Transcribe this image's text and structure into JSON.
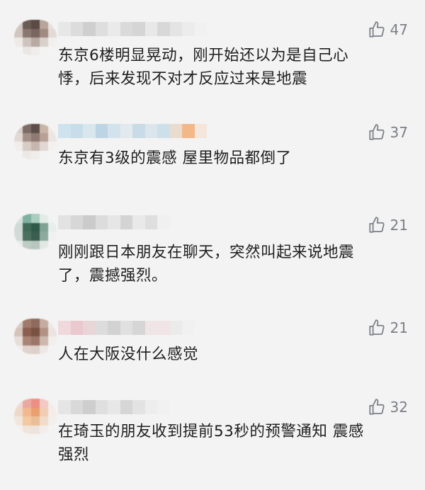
{
  "comments": [
    {
      "likes": "47",
      "text": "东京6楼明显晃动，刚开始还以为是自己心\n悸，后来发现不对才反应过来是地震",
      "avatar_colors": [
        "#cfc7c2",
        "#6b5b55",
        "#5a4a45",
        "#b9a49b",
        "#e8e0dc",
        "#d2c6c0",
        "#8a7770",
        "#7a6660",
        "#a08a82",
        "#e2dad6",
        "#eeeae8",
        "#cfc4bf",
        "#b8a9a3",
        "#d9d0cc",
        "#f2f0ef",
        "#f4f4f4",
        "#e9e6e4",
        "#efedec",
        "#f3f3f3",
        "#f4f4f4"
      ],
      "name_colors": [
        "#e7e7e7",
        "#dcdcdc",
        "#cfcfcf",
        "#dedede",
        "#eaeaea",
        "#dadada",
        "#d5d5d5",
        "#e8e8e8",
        "#d8d8d8",
        "#e4e4e4",
        "#ececec",
        "#f1f1f1"
      ]
    },
    {
      "likes": "37",
      "text": "东京有3级的震感 屋里物品都倒了",
      "avatar_colors": [
        "#d8cfcb",
        "#7d6b66",
        "#5d4e4a",
        "#c9b4a8",
        "#efe8e4",
        "#e3d9d4",
        "#a39089",
        "#8e7a73",
        "#b8a096",
        "#ece6e2",
        "#f0edeb",
        "#d7ccc6",
        "#c7b6ae",
        "#e1d8d3",
        "#f3f1f0",
        "#f4f4f4",
        "#ebe8e6",
        "#efedec",
        "#f3f3f3",
        "#f4f4f4"
      ],
      "name_colors": [
        "#cfe3ee",
        "#c8dde9",
        "#d9e6ee",
        "#bcd4e3",
        "#d3e3ed",
        "#e2eaef",
        "#c9dbe6",
        "#dbe5ec",
        "#cde0ea",
        "#e9dccf",
        "#f2b88a",
        "#f3e6dc"
      ]
    },
    {
      "likes": "21",
      "text": "刚刚跟日本朋友在聊天，突然叫起来说地震\n了，震撼强烈。",
      "avatar_colors": [
        "#d7e2de",
        "#7fb0a0",
        "#a9cdbf",
        "#e3ebe8",
        "#f1f3f2",
        "#cfd9d5",
        "#3f6b5a",
        "#2f5a48",
        "#7fa293",
        "#e8eeeb",
        "#d2dbd7",
        "#4b6f60",
        "#3a5e4f",
        "#8eaa9e",
        "#eef1f0",
        "#e6ebe9",
        "#bfccc6",
        "#b8c6c0",
        "#e2e8e5",
        "#f3f3f3"
      ],
      "name_colors": [
        "#e2e2e2",
        "#d7d7d7",
        "#cbcbcb",
        "#dcdcdc",
        "#e6e6e6",
        "#d4d4d4",
        "#e9e9e9",
        "#dedede",
        "#f0f0f0",
        "#f3f3f3",
        "#f3f3f3",
        "#f3f3f3"
      ]
    },
    {
      "likes": "21",
      "text": "人在大阪没什么感觉",
      "avatar_colors": [
        "#d9ccc6",
        "#a07a6c",
        "#8f6a5d",
        "#c4aca2",
        "#eee8e5",
        "#d6c3ba",
        "#8b5e4f",
        "#7a5244",
        "#b39284",
        "#ebe4e0",
        "#e8ddd8",
        "#a98576",
        "#9c7768",
        "#cdb8ae",
        "#f1eeec",
        "#f0ece9",
        "#e0d3cd",
        "#ddd0ca",
        "#ede8e5",
        "#f4f4f4"
      ],
      "name_colors": [
        "#f0d9dd",
        "#eac8ce",
        "#e8d5d8",
        "#dcdcdc",
        "#d2d2d2",
        "#e0e0e0",
        "#d6d6d6",
        "#efe4e6",
        "#f2e3e6",
        "#ebebeb",
        "#f1f1f1",
        "#f3f3f3"
      ]
    },
    {
      "likes": "32",
      "text": "在琦玉的朋友收到提前53秒的预警通知 震感\n强烈",
      "avatar_colors": [
        "#f1d7d3",
        "#e9a8a0",
        "#ee8f86",
        "#f2c9c4",
        "#f3ecea",
        "#eed9c8",
        "#f2b98f",
        "#e9a06e",
        "#f0cdb4",
        "#f3ece7",
        "#f1e6dd",
        "#f2c9a0",
        "#eabf98",
        "#f1dccb",
        "#f3efec",
        "#f3f0ed",
        "#efe5dc",
        "#eee4dd",
        "#f2eeeb",
        "#f4f4f4"
      ],
      "name_colors": [
        "#e5e5e5",
        "#d9d9d9",
        "#cecece",
        "#dfdfdf",
        "#e7e7e7",
        "#d6d6d6",
        "#e3e3e3",
        "#ededed",
        "#f1f1f1",
        "#f3f3f3",
        "#f3f3f3",
        "#f3f3f3"
      ]
    }
  ],
  "colors": {
    "background": "#f3f3f3",
    "text": "#1e1e1e",
    "like_gray": "#7b7f86"
  },
  "icons": {
    "like": "thumbs-up-icon"
  }
}
